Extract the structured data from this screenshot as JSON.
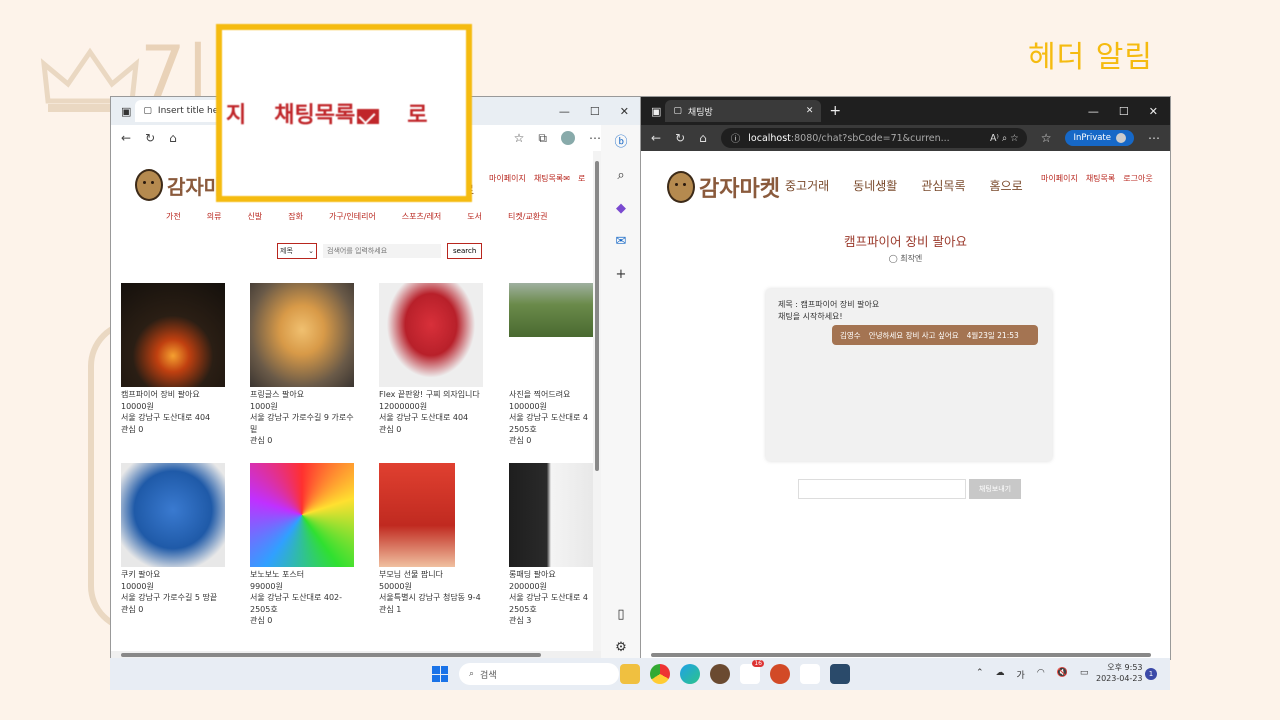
{
  "slide": {
    "title": "헤더 알림",
    "bg_text": "7|"
  },
  "left_browser": {
    "tab_title": "Insert title he",
    "site": {
      "logo": "감자마",
      "logo_suffix": "로",
      "top_links": [
        "마이페이지",
        "채팅목록",
        "로"
      ],
      "categories": [
        "가전",
        "의류",
        "신발",
        "잡화",
        "가구/인테리어",
        "스포츠/레저",
        "도서",
        "티켓/교환권"
      ],
      "search": {
        "select_value": "제목",
        "placeholder": "검색어를 입력하세요",
        "button": "search"
      },
      "products": [
        {
          "title": "캠프파이어 장비 팔아요",
          "price": "10000원",
          "address": "서울 강남구 도산대로 404",
          "likes": "관심 0",
          "color": "#3a2a1c"
        },
        {
          "title": "프링글스 팔아요",
          "price": "1000원",
          "address": "서울 강남구 가로수길 9 가로수 밑",
          "likes": "관심 0",
          "color": "#c88a40"
        },
        {
          "title": "Flex 끝판왕! 구찌 의자입니다",
          "price": "12000000원",
          "address": "서울 강남구 도산대로 404",
          "likes": "관심 0",
          "color": "#c82a30"
        },
        {
          "title": "사진을 찍어드려요",
          "price": "100000원",
          "address": "서울 강남구 도산대로 4 2505호",
          "likes": "관심 0",
          "color": "#6a7a48"
        },
        {
          "title": "쿠키 팔아요",
          "price": "10000원",
          "address": "서울 강남구 가로수길 5 땅끝",
          "likes": "관심 0",
          "color": "#2f6ab8"
        },
        {
          "title": "보노보노 포스터",
          "price": "99000원",
          "address": "서울 강남구 도산대로 402-2505호",
          "likes": "관심 0",
          "color": "#4fb0e0"
        },
        {
          "title": "부모님 선물 팝니다",
          "price": "50000원",
          "address": "서울특별시 강남구 청담동 9-4",
          "likes": "관심 1",
          "color": "#c83a2c"
        },
        {
          "title": "롱패딩 팔아요",
          "price": "200000원",
          "address": "서울 강남구 도산대로 4 2505호",
          "likes": "관심 3",
          "color": "#2a2a2a"
        }
      ]
    }
  },
  "zoom_callout": {
    "text_left": "지",
    "text_main": "채팅목록",
    "text_right": "로"
  },
  "right_browser": {
    "tab_title": "채팅방",
    "url_host": "localhost",
    "url_rest": ":8080/chat?sbCode=71&curren...",
    "inprivate": "InPrivate",
    "site": {
      "logo": "감자마켓",
      "nav": [
        "중고거래",
        "동네생활",
        "관심목록",
        "홈으로"
      ],
      "top_links": [
        "마이페이지",
        "채팅목록",
        "로그아웃"
      ],
      "chat_title": "캠프파이어 장비 팔아요",
      "chat_user": "최작엔",
      "chat_subject": "제목 : 캠프파이어 장비 팔아요",
      "chat_start": "채팅을 시작하세요!",
      "message": {
        "sender": "김영수",
        "text": "안녕하세요 장비 사고 싶어요",
        "time": "4월23일 21:53"
      },
      "send_button": "채팅보내기"
    }
  },
  "taskbar": {
    "search": "검색",
    "tray_lang": "가",
    "time": "오후 9:53",
    "date": "2023-04-23",
    "notification_count": "1",
    "badge": "16"
  },
  "colors": {
    "accent_yellow": "#f5bb10",
    "brand_red": "#b8261e",
    "brand_brown": "#8a5a3c"
  }
}
